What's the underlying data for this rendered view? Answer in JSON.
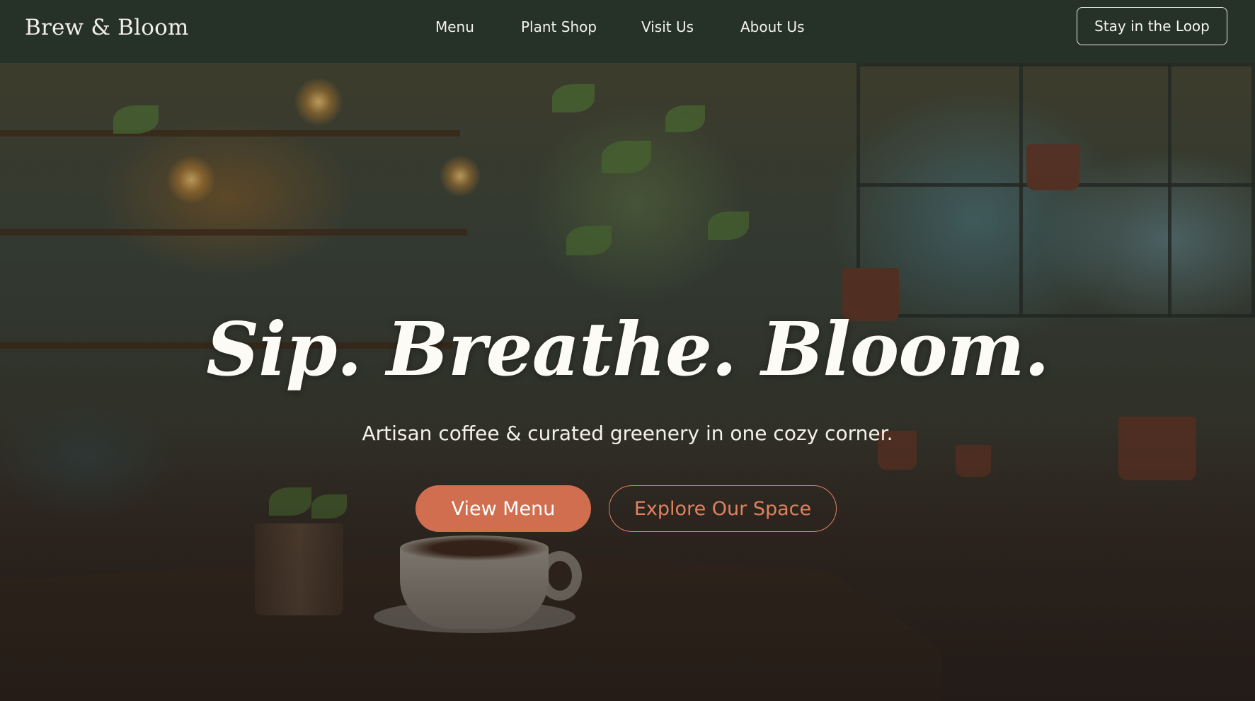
{
  "header": {
    "brand": "Brew & Bloom",
    "nav": [
      {
        "label": "Menu"
      },
      {
        "label": "Plant Shop"
      },
      {
        "label": "Visit Us"
      },
      {
        "label": "About Us"
      }
    ],
    "cta_label": "Stay in the Loop"
  },
  "hero": {
    "title": "Sip. Breathe. Bloom.",
    "subtitle": "Artisan coffee & curated greenery in one cozy corner.",
    "primary_button": "View Menu",
    "secondary_button": "Explore Our Space",
    "background_image": "cozy cafe interior with hanging plants, shelves with warm lights, window with potted plants, coffee cup on wooden table"
  },
  "colors": {
    "header_bg": "#263128",
    "accent": "#d06e4f",
    "accent_outline": "#e0825f",
    "text_light": "#fcfbf6"
  }
}
